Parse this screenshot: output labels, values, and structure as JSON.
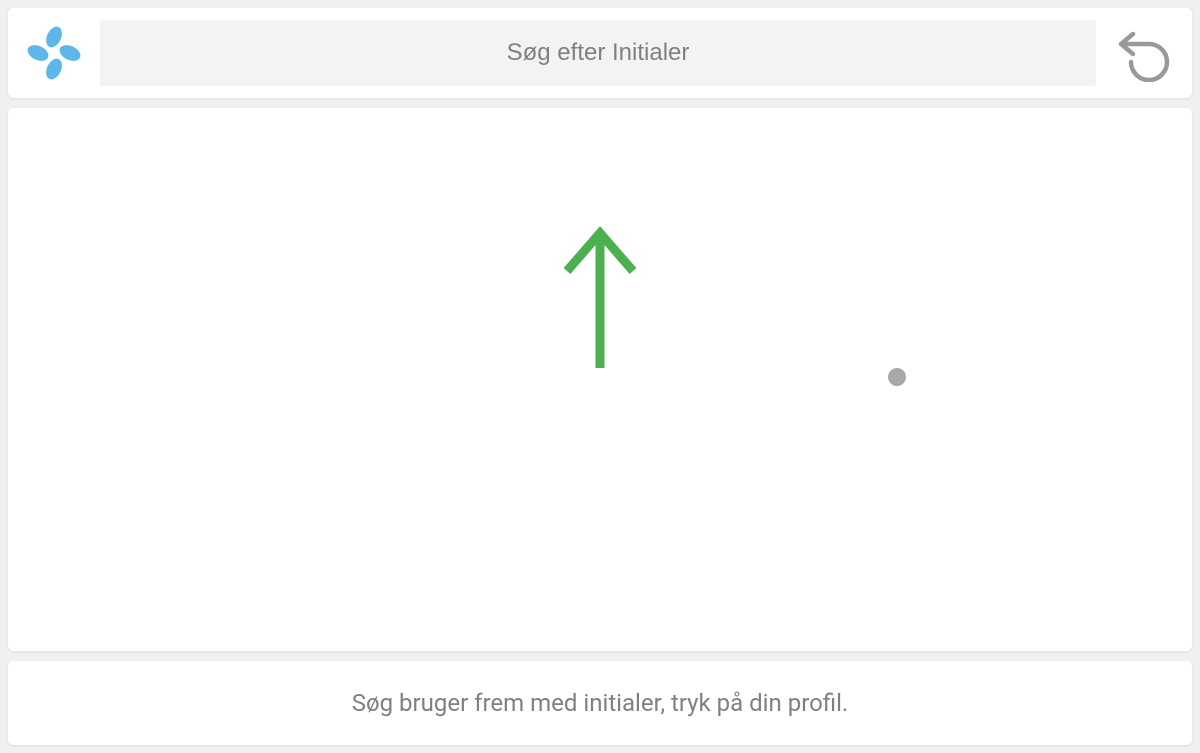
{
  "header": {
    "search_placeholder": "Søg efter Initialer",
    "search_value": ""
  },
  "main": {
    "arrow_color": "#4caf50"
  },
  "footer": {
    "instruction_text": "Søg bruger frem med initialer, tryk på din profil."
  },
  "colors": {
    "logo_blue": "#5eb7e8",
    "icon_gray": "#999999",
    "bg_gray": "#f0f0f0",
    "card_white": "#ffffff"
  }
}
